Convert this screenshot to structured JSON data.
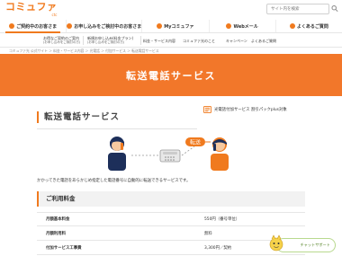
{
  "header": {
    "logo_text": "コミュファ",
    "logo_sub": "ctc",
    "search_placeholder": "サイト内を検索"
  },
  "nav": {
    "items": [
      {
        "label": "ご契約中のお客さま",
        "icon": "person-icon"
      },
      {
        "label": "お申し込みをご検討中のお客さま",
        "icon": "house-icon"
      },
      {
        "label": "Myコミュファ",
        "icon": "user-icon"
      },
      {
        "label": "Webメール",
        "icon": "mail-icon"
      },
      {
        "label": "よくあるご質問",
        "icon": "question-icon"
      }
    ]
  },
  "subnav": {
    "items": [
      {
        "line1": "お得なご契約のご案内",
        "line2": "(お申し込みをご検討の方)"
      },
      {
        "line1": "新規お申し込み(料金プラン)",
        "line2": "(お申し込みをご検討の方)"
      },
      {
        "line1": "料金・サービス内容",
        "line2": ""
      },
      {
        "line1": "コミュファ光のこと",
        "line2": ""
      },
      {
        "line1": "キャンペーン",
        "line2": ""
      },
      {
        "line1": "よくあるご質問",
        "line2": ""
      }
    ]
  },
  "breadcrumb": "コミュファ光 公式サイト ＞ 料金・サービス内容 ＞ 光電話 ＞ 付加サービス ＞ 転送電話サービス",
  "hero": {
    "title": "転送電話サービス"
  },
  "page": {
    "heading": "転送電話サービス",
    "discount_badge": "光電話付加サービス 割引パックplus対象",
    "illustration_label": "転送",
    "description": "かかってきた電話をあらかじめ指定した電話番号に自動的に転送できるサービスです。"
  },
  "fees": {
    "heading": "ご利用料金",
    "rows": [
      {
        "label": "月額基本料金",
        "value": "550円（番号単位）"
      },
      {
        "label": "月額利用料",
        "value": "無料"
      },
      {
        "label": "付加サービス工事費",
        "value": "3,300円／契約"
      },
      {
        "label": "",
        "value": ""
      }
    ]
  },
  "chat": {
    "label": "チャットサポート"
  },
  "colors": {
    "accent": "#f07a1e",
    "hero": "#f2772a",
    "chat": "#4f7f1f"
  }
}
